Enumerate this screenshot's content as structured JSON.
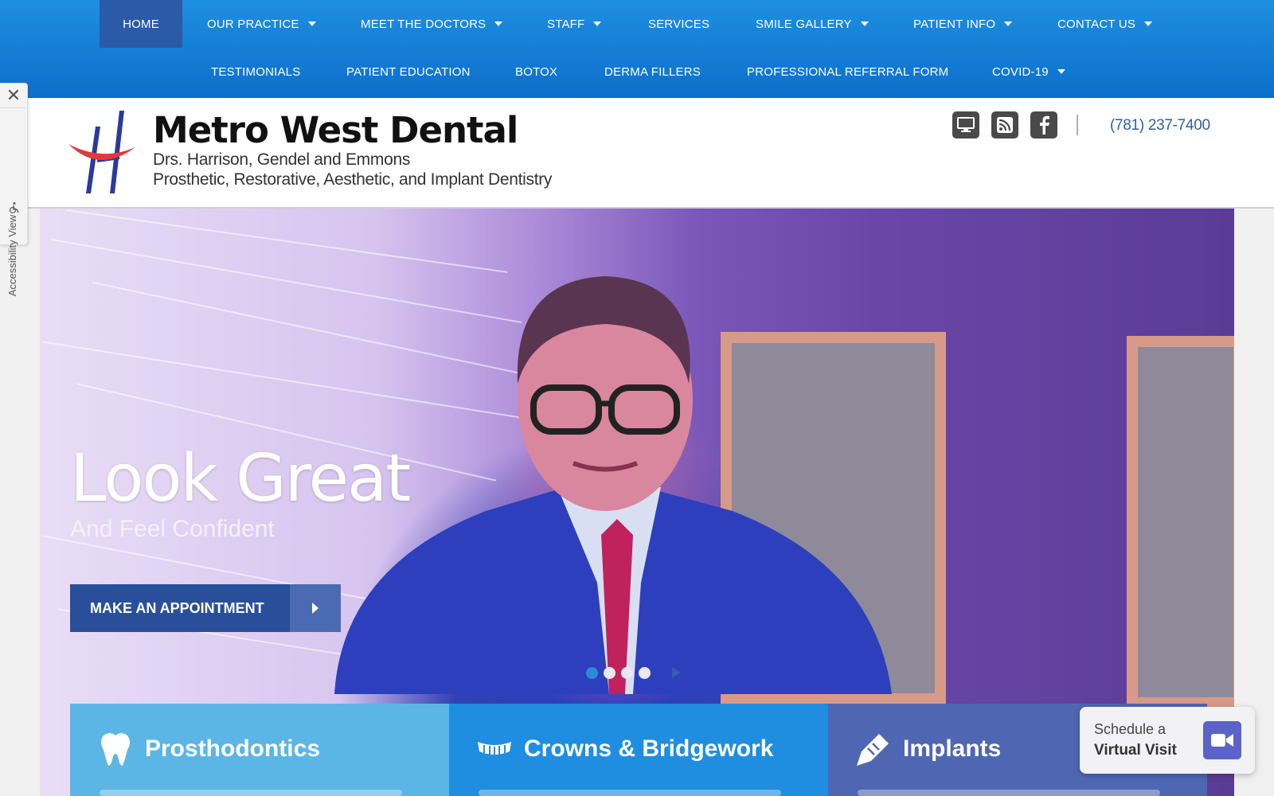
{
  "nav": {
    "row1": [
      {
        "label": "HOME",
        "active": true
      },
      {
        "label": "OUR PRACTICE",
        "dropdown": true
      },
      {
        "label": "MEET THE DOCTORS",
        "dropdown": true
      },
      {
        "label": "STAFF",
        "dropdown": true
      },
      {
        "label": "SERVICES"
      },
      {
        "label": "SMILE GALLERY",
        "dropdown": true
      },
      {
        "label": "PATIENT INFO",
        "dropdown": true
      },
      {
        "label": "CONTACT US",
        "dropdown": true
      }
    ],
    "row2": [
      {
        "label": "TESTIMONIALS"
      },
      {
        "label": "PATIENT EDUCATION"
      },
      {
        "label": "BOTOX"
      },
      {
        "label": "DERMA FILLERS"
      },
      {
        "label": "PROFESSIONAL REFERRAL FORM"
      },
      {
        "label": "COVID-19",
        "dropdown": true
      }
    ]
  },
  "accessibility": {
    "label": "Accessibility View",
    "close_icon": "close-icon",
    "person_icon": "accessibility-person-icon"
  },
  "header": {
    "brand": "Metro West Dental",
    "doctors": "Drs. Harrison, Gendel and Emmons",
    "specialties": "Prosthetic, Restorative, Aesthetic, and Implant Dentistry",
    "social_icons": [
      "desktop-icon",
      "rss-icon",
      "facebook-icon"
    ],
    "phone": "(781) 237-7400"
  },
  "hero": {
    "title": "Look Great",
    "subtitle": "And Feel Confident",
    "cta_label": "MAKE AN APPOINTMENT",
    "slides": 4,
    "active_slide": 1
  },
  "cards": [
    {
      "title": "Prosthodontics",
      "icon": "tooth-icon",
      "color": "#5bb6e6"
    },
    {
      "title": "Crowns & Bridgework",
      "icon": "teeth-icon",
      "color": "#1f8ee0"
    },
    {
      "title": "Implants",
      "icon": "implant-icon",
      "color": "#4f67b3"
    }
  ],
  "virtual_visit": {
    "line1": "Schedule a",
    "line2": "Virtual Visit",
    "icon": "video-camera-icon"
  },
  "colors": {
    "nav": "#1e8fe0",
    "nav_active": "#2a5aa8",
    "cta": "#2a4f9a",
    "phone": "#2f5f9e",
    "video_btn": "#5b62c9"
  }
}
